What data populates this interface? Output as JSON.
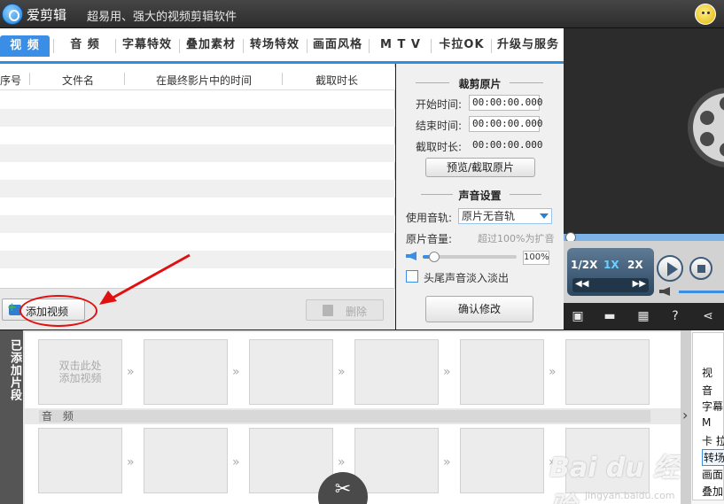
{
  "titlebar": {
    "app_name": "爱剪辑",
    "slogan": "超易用、强大的视频剪辑软件"
  },
  "tabs": [
    "视 频",
    "音 频",
    "字幕特效",
    "叠加素材",
    "转场特效",
    "画面风格",
    "M T V",
    "卡拉OK",
    "升级与服务"
  ],
  "file_list": {
    "columns": [
      "序号",
      "文件名",
      "在最终影片中的时间",
      "截取时长"
    ],
    "add_label": "添加视频",
    "delete_label": "删除"
  },
  "edit_panel": {
    "clip_title": "裁剪原片",
    "start_label": "开始时间:",
    "start_value": "00:00:00.000",
    "end_label": "结束时间:",
    "end_value": "00:00:00.000",
    "duration_label": "截取时长:",
    "duration_value": "00:00:00.000",
    "preview_button": "预览/截取原片",
    "audio_title": "声音设置",
    "track_label": "使用音轨:",
    "track_value": "原片无音轨",
    "volume_label": "原片音量:",
    "volume_hint": "超过100%为扩音",
    "volume_value": "100%",
    "volume_level": 0.12,
    "fade_label": "头尾声音淡入淡出",
    "confirm_button": "确认修改"
  },
  "player": {
    "speeds": [
      "1/2X",
      "1X",
      "2X"
    ],
    "active_speed": "1X",
    "volume_level": 1.0
  },
  "timeline": {
    "side_label": "已添加片段",
    "placeholder": "双击此处添加视频",
    "audio_label": "音 频"
  },
  "right_list": [
    "视",
    "音",
    "字幕",
    "M",
    "卡 拉",
    "转场",
    "画面",
    "叠加"
  ],
  "watermark": {
    "logo": "Bai du 经验",
    "url": "jingyan.baidu.com"
  },
  "colors": {
    "accent": "#3a8ee6",
    "annotation": "#e01010"
  }
}
